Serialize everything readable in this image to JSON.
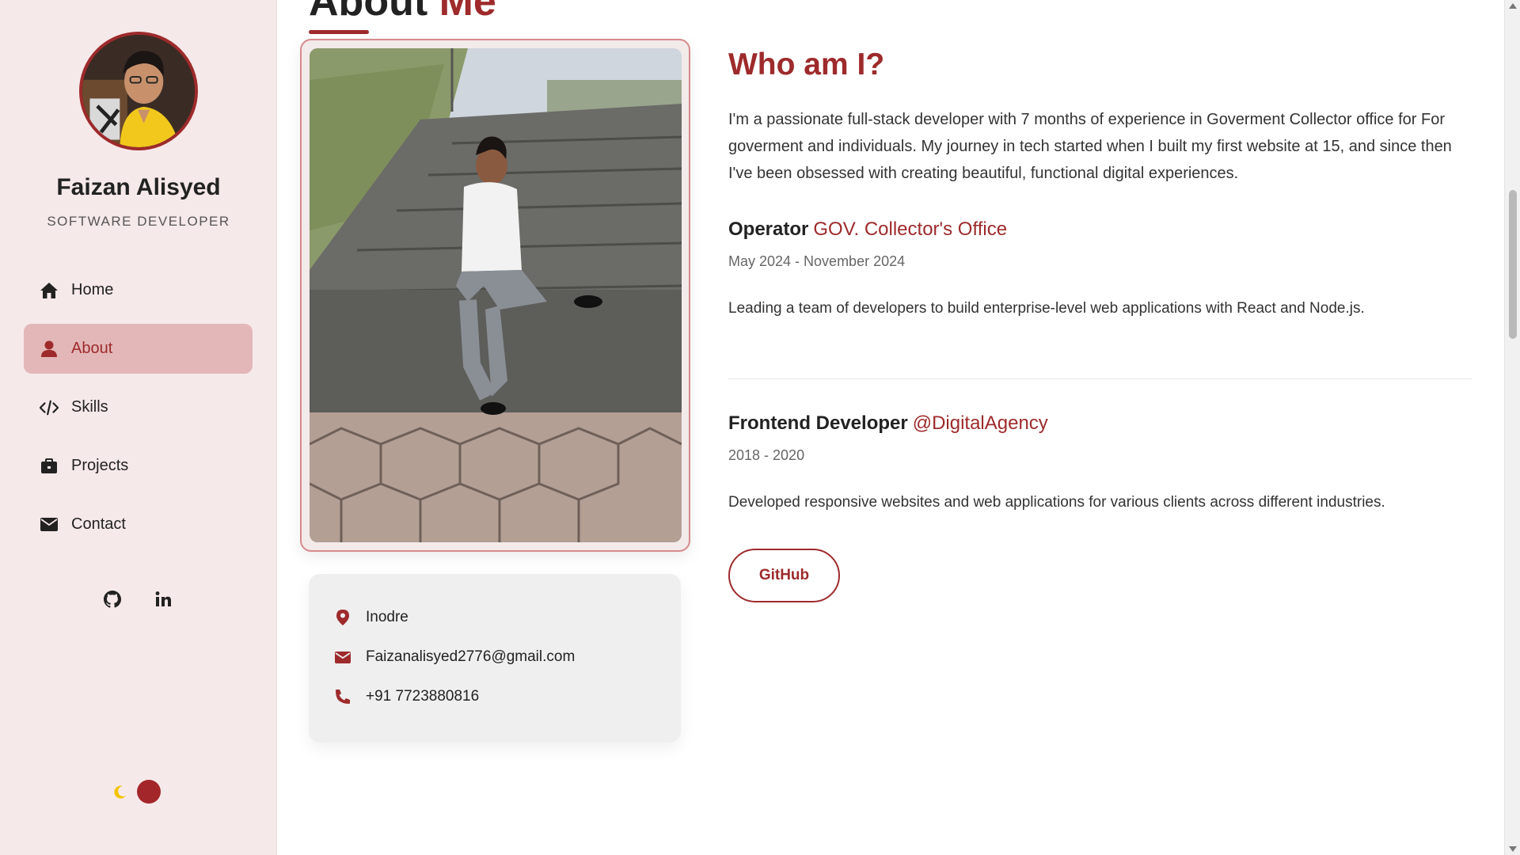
{
  "profile": {
    "name": "Faizan Alisyed",
    "role": "SOFTWARE DEVELOPER"
  },
  "nav": {
    "items": [
      {
        "label": "Home",
        "icon": "home-icon",
        "active": false
      },
      {
        "label": "About",
        "icon": "user-icon",
        "active": true
      },
      {
        "label": "Skills",
        "icon": "code-icon",
        "active": false
      },
      {
        "label": "Projects",
        "icon": "briefcase-icon",
        "active": false
      },
      {
        "label": "Contact",
        "icon": "envelope-icon",
        "active": false
      }
    ]
  },
  "socials": [
    {
      "icon": "github-icon"
    },
    {
      "icon": "linkedin-icon"
    }
  ],
  "section": {
    "title_main": "About ",
    "title_accent": "Me"
  },
  "contact_info": {
    "location": "Inodre",
    "email": "Faizanalisyed2776@gmail.com",
    "phone": "+91 7723880816"
  },
  "about": {
    "heading": "Who am I?",
    "bio": "I'm a passionate full-stack developer with 7 months of experience in Goverment Collector office for For goverment and individuals. My journey in tech started when I built my first website at 15, and since then I've been obsessed with creating beautiful, functional digital experiences."
  },
  "experience": [
    {
      "role": "Operator",
      "org": "GOV. Collector's Office",
      "dates": "May 2024 - November 2024",
      "description": "Leading a team of developers to build enterprise-level web applications with React and Node.js."
    },
    {
      "role": "Frontend Developer",
      "org": "@DigitalAgency",
      "dates": "2018 - 2020",
      "description": "Developed responsive websites and web applications for various clients across different industries."
    }
  ],
  "buttons": {
    "github": "GitHub"
  },
  "colors": {
    "accent": "#9e2a2b",
    "sidebar_bg": "#f6e9ea",
    "active_nav_bg": "#e3b7b8",
    "moon": "#f2c400"
  }
}
